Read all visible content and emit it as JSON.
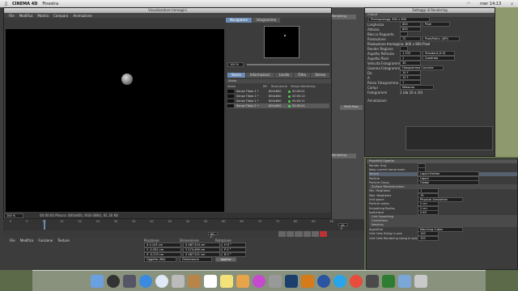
{
  "menubar": {
    "app_name": "CINEMA 4D",
    "menu_window": "Finestra",
    "clock": "mer 14:13"
  },
  "viewer": {
    "title": "Visualizzatore Immagini",
    "menu": [
      "File",
      "Modifica",
      "Mostra",
      "Compara",
      "Animazione"
    ],
    "zoom_value": "100 %",
    "status_text": "00:00:00  Misura: 800x800, RGB (8Bit), 81.30 KB",
    "nav_tabs": [
      "Navigatore",
      "Istogramma"
    ],
    "nav_zoom": "100 %",
    "info_tabs": [
      "Storia",
      "Informazioni",
      "Livello",
      "Filtro",
      "Stereo"
    ],
    "history_label": "Storia",
    "history_columns": [
      "Nome",
      "RR",
      "Risoluzione",
      "Tempo Rendering"
    ],
    "history_rows": [
      {
        "name": "Senza Titolo 1 *",
        "res": "800x800",
        "time": "00:00:01"
      },
      {
        "name": "Senza Titolo 1 *",
        "res": "800x800",
        "time": "00:00:12"
      },
      {
        "name": "Senza Titolo 1 *",
        "res": "800x800",
        "time": "00:00:11"
      },
      {
        "name": "Senza Titolo 1 *",
        "res": "800x800",
        "time": "00:00:01"
      }
    ]
  },
  "render_settings": {
    "title": "Settaggi di Rendering",
    "section": "Output",
    "preset": "Preimpostagg: 800 x 600",
    "fields": [
      {
        "label": "Larghezza",
        "value": "800",
        "unit": "Pixel"
      },
      {
        "label": "Altezza",
        "value": "800",
        "unit": ""
      },
      {
        "label": "Blocca Rapporto",
        "value": "",
        "unit": ""
      },
      {
        "label": "Risoluzione",
        "value": "72",
        "unit": "Pixel/Pollici (DPI)"
      },
      {
        "label": "Risoluzione Immagine: 800 x 800 Pixel",
        "value": "",
        "unit": ""
      },
      {
        "label": "Render Regione",
        "value": "",
        "unit": ""
      },
      {
        "label": "Aspetto Pellicola",
        "value": "1.333",
        "unit": "Standard (4:3)"
      },
      {
        "label": "Aspetto Pixel",
        "value": "1",
        "unit": "Quadrato"
      },
      {
        "label": "Velocità Fotogramma",
        "value": "30",
        "unit": ""
      },
      {
        "label": "Gamma Fotogramma",
        "value": "Fotogramma Corrente",
        "unit": ""
      },
      {
        "label": "Da",
        "value": "10 F",
        "unit": ""
      },
      {
        "label": "A",
        "value": "10 F",
        "unit": ""
      },
      {
        "label": "Passo Fotogramma",
        "value": "1",
        "unit": ""
      },
      {
        "label": "Campi",
        "value": "Nessuno",
        "unit": ""
      },
      {
        "label": "Fotogrammi",
        "value": "1 (da 10 a 10)",
        "unit": ""
      }
    ],
    "notes_label": "Annotazioni"
  },
  "object_props": {
    "title": "Proprietà Oggetto",
    "fields": [
      {
        "label": "Render Only",
        "value": ""
      },
      {
        "label": "Keep current frame mesh",
        "value": ""
      },
      {
        "label": "Source",
        "value": "Liquid Emitter"
      },
      {
        "label": "Particle",
        "value": "Liquid"
      },
      {
        "label": "Particle Group",
        "value": "Global"
      },
      {
        "label": "Surface Reconstruction",
        "value": ""
      },
      {
        "label": "Min. Neighbors",
        "value": "1"
      },
      {
        "label": "Max. Neighbors",
        "value": "15"
      },
      {
        "label": "Unit space",
        "value": "Physical Simulation"
      },
      {
        "label": "Particle radius",
        "value": "2 cm"
      },
      {
        "label": "Smoothing Radius",
        "value": "2 cm"
      },
      {
        "label": "IsoSurface",
        "value": "0.63"
      },
      {
        "label": "Grid Smoothing",
        "value": ""
      },
      {
        "label": "Corrections",
        "value": ""
      },
      {
        "label": "Meshing",
        "value": ""
      },
      {
        "label": "Algorithm",
        "value": "Marching Cubes"
      },
      {
        "label": "Grid Cells Sizing in axis",
        "value": "100"
      },
      {
        "label": "Grid Cells Rendering sizing in axis",
        "value": "150"
      }
    ]
  },
  "coords": {
    "headers": [
      "Posizione",
      "Dimensione",
      "Rotazione"
    ],
    "rows": [
      {
        "p": "X  0.103 cm",
        "d": "X  487.524 cm",
        "r": "H  0 °"
      },
      {
        "p": "Y  -0.552 cm",
        "d": "Y  270.496 cm",
        "r": "P  0 °"
      },
      {
        "p": "Z  -0.233 cm",
        "d": "Z  487.521 cm",
        "r": "B  0 °"
      }
    ],
    "mode": "Oggetto (Rel)",
    "size_mode": "Dimensione",
    "apply": "Applica"
  },
  "material_menu": [
    "File",
    "Modifica",
    "Funzione",
    "Texture"
  ],
  "side_buttons": {
    "multipass": "Multi-Pass",
    "rendering": "Rendering"
  },
  "timeline": {
    "ticks": [
      "0",
      "5",
      "10",
      "15",
      "20",
      "25",
      "30",
      "35",
      "40",
      "45",
      "50",
      "55",
      "60",
      "65",
      "70",
      "75",
      "80",
      "85",
      "90"
    ],
    "frame": "10 F",
    "end": "90 F"
  },
  "colors": {
    "accent": "#6c8cb4",
    "green": "#4fd24f"
  }
}
